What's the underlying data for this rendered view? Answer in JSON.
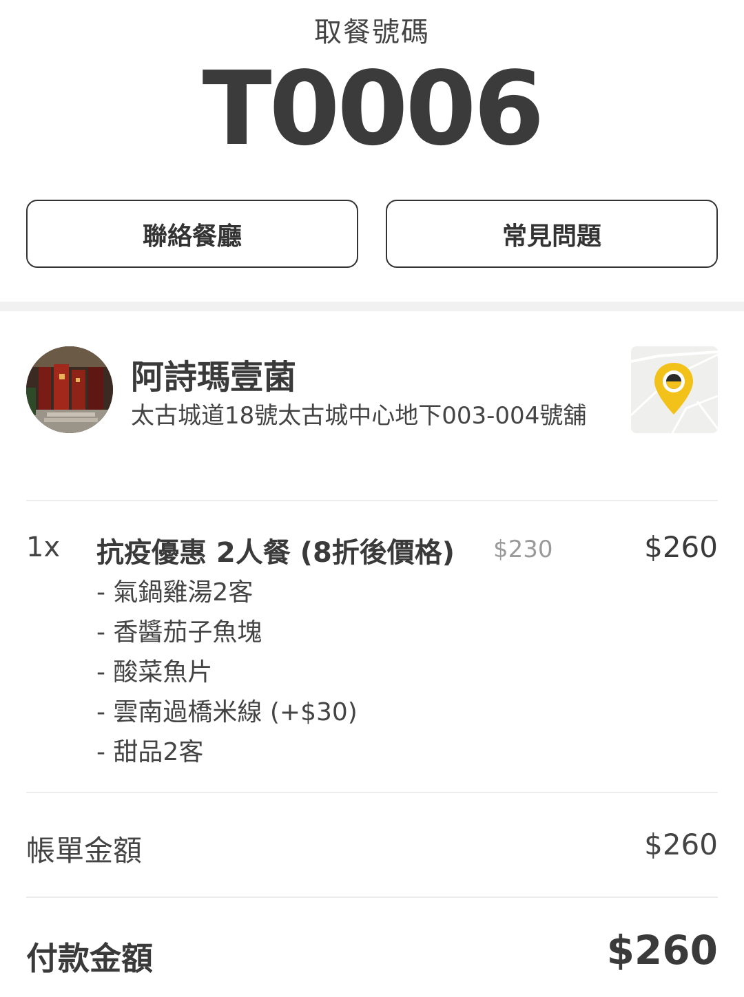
{
  "pickup": {
    "label": "取餐號碼",
    "number": "T0006"
  },
  "actions": {
    "contact_label": "聯絡餐廳",
    "faq_label": "常見問題"
  },
  "restaurant": {
    "name": "阿詩瑪壹菌",
    "address": "太古城道18號太古城中心地下003-004號舖",
    "map_icon": "map-pin-icon"
  },
  "order": {
    "items": [
      {
        "quantity": "1x",
        "title": "抗疫優惠 2人餐 (8折後價格)",
        "original_price": "$230",
        "price": "$260",
        "options": [
          "- 氣鍋雞湯2客",
          "- 香醬茄子魚塊",
          "- 酸菜魚片",
          "- 雲南過橋米線 (+$30)",
          "- 甜品2客"
        ]
      }
    ]
  },
  "summary": {
    "bill_label": "帳單金額",
    "bill_value": "$260",
    "pay_label": "付款金額",
    "pay_value": "$260"
  },
  "colors": {
    "text": "#3a3a3a",
    "muted": "#9a9a9a",
    "pin": "#f2c21b",
    "divider": "#f1f1f1"
  }
}
